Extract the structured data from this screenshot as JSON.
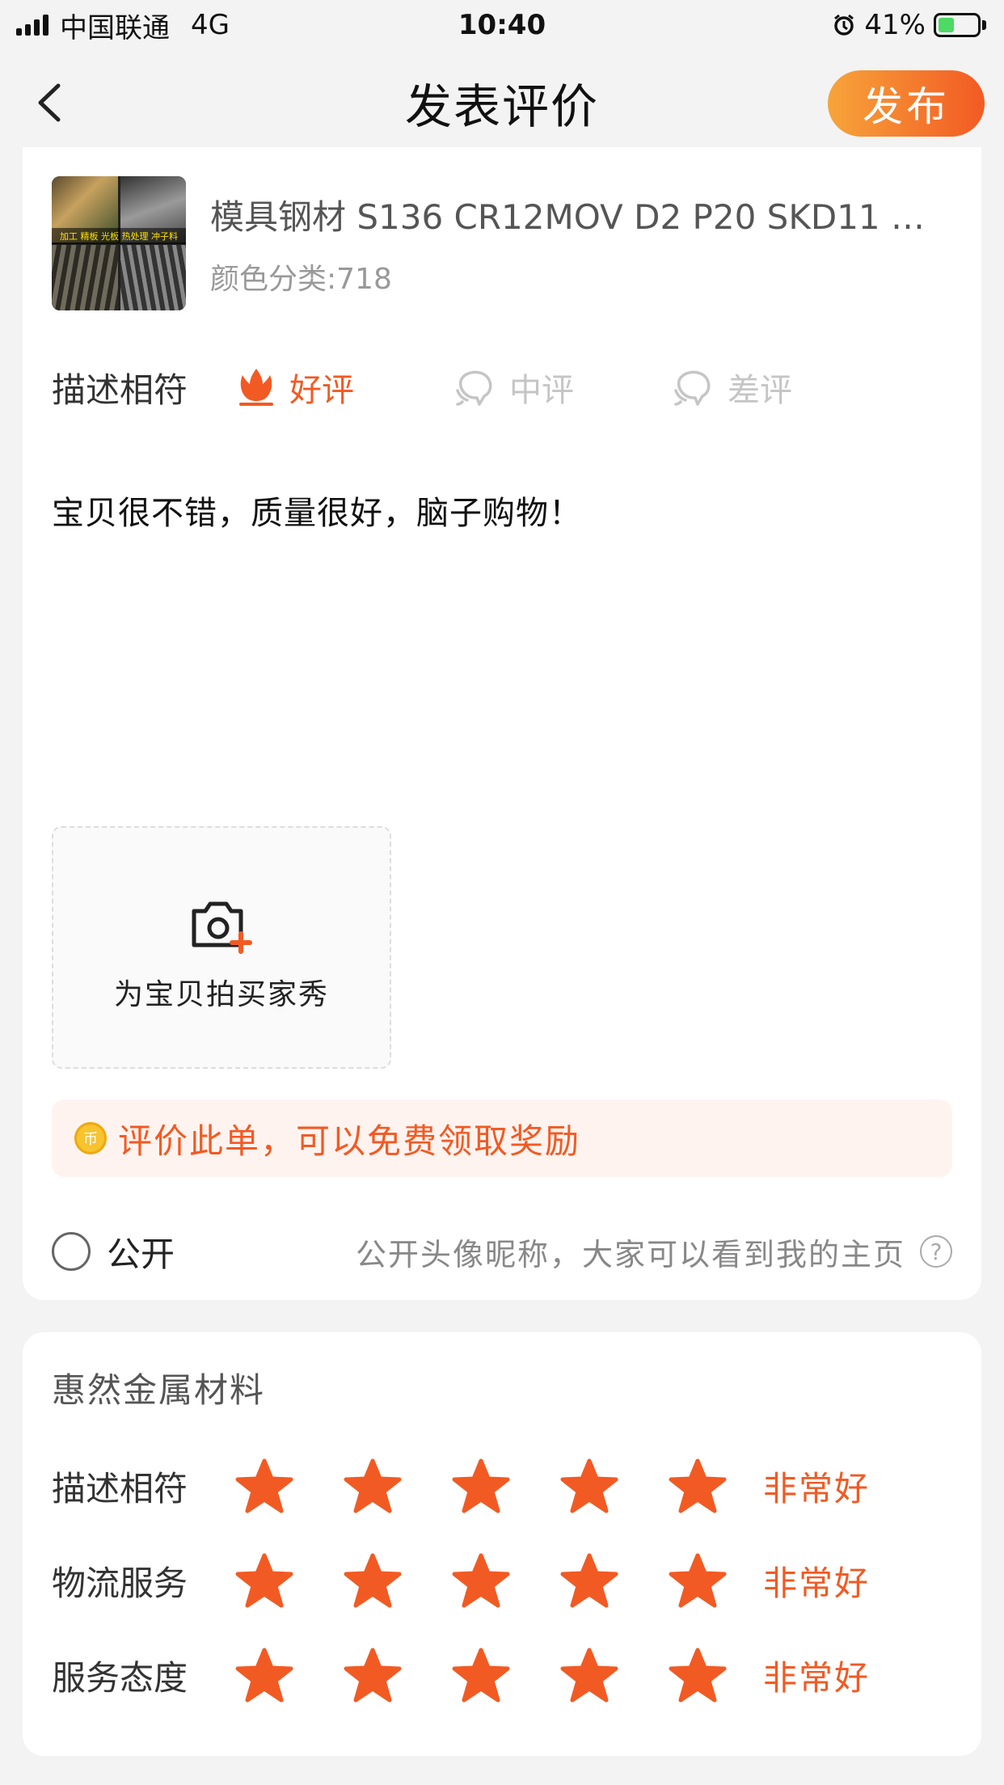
{
  "status_bar": {
    "carrier": "中国联通",
    "network": "4G",
    "time": "10:40",
    "battery": "41%",
    "battery_level": 0.41
  },
  "nav": {
    "title": "发表评价",
    "publish_label": "发布"
  },
  "product": {
    "thumb_caption": "加工 精板 光板 热处理 冲子料",
    "title": "模具钢材 S136 CR12MOV D2 P20 SKD11 D...",
    "spec": "颜色分类:718"
  },
  "rating": {
    "label": "描述相符",
    "options": [
      {
        "label": "好评",
        "selected": true
      },
      {
        "label": "中评",
        "selected": false
      },
      {
        "label": "差评",
        "selected": false
      }
    ]
  },
  "review": {
    "text": "宝贝很不错，质量很好，脑子购物！"
  },
  "photo": {
    "label": "为宝贝拍买家秀"
  },
  "reward": {
    "text": "评价此单，可以免费领取奖励"
  },
  "public": {
    "label": "公开",
    "hint": "公开头像昵称，大家可以看到我的主页",
    "help": "?"
  },
  "shop": {
    "name": "惠然金属材料",
    "rows": [
      {
        "label": "描述相符",
        "stars": 5,
        "value": "非常好"
      },
      {
        "label": "物流服务",
        "stars": 5,
        "value": "非常好"
      },
      {
        "label": "服务态度",
        "stars": 5,
        "value": "非常好"
      }
    ]
  },
  "colors": {
    "accent": "#f25a23",
    "star": "#f25a23",
    "inactive": "#c5c5c5"
  }
}
